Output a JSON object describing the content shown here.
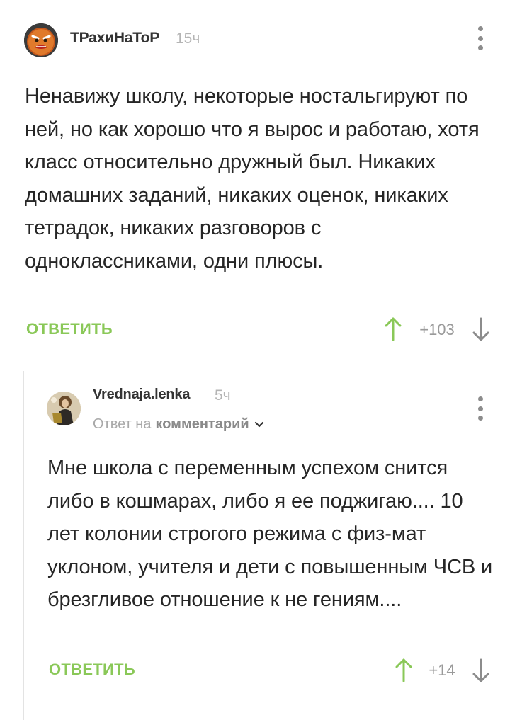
{
  "comments": [
    {
      "username": "ТРахиНаТоР",
      "time": "15ч",
      "text": "Ненавижу школу, некоторые ностальгируют по ней, но как хорошо что я вырос и работаю, хотя класс относительно дружный был. Никаких домашних заданий, никаких оценок, никаких тетрадок, никаких разговоров с одноклассниками, одни плюсы.",
      "reply_label": "ОТВЕТИТЬ",
      "rating": "+103",
      "avatar_icon": "gingerbread-avatar"
    },
    {
      "username": "Vrednaja.lenka",
      "time": "5ч",
      "reply_to_prefix": "Ответ на",
      "reply_to_link": "комментарий",
      "text": "Мне школа с переменным успехом снится либо в кошмарах, либо я ее поджигаю.... 10 лет колонии строгого режима с физ-мат уклоном, учителя и дети с повышенным ЧСВ и брезгливое отношение к не гениям....",
      "reply_label": "ОТВЕТИТЬ",
      "rating": "+14",
      "avatar_icon": "photo-avatar"
    }
  ],
  "colors": {
    "accent_green": "#8ac858",
    "muted_gray": "#9a9a9a",
    "thread_line": "#e3e3e3"
  },
  "icons": {
    "more": "vertical-dots-icon",
    "upvote": "arrow-up-icon",
    "downvote": "arrow-down-icon",
    "chevron": "chevron-down-icon"
  }
}
